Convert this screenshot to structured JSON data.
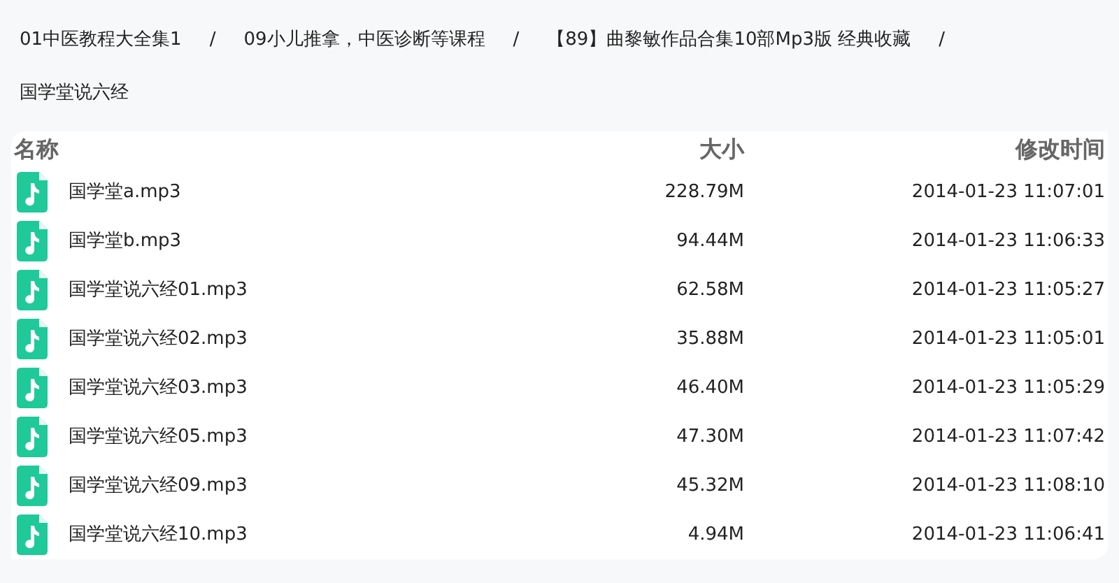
{
  "breadcrumb": {
    "separator": "/",
    "items": [
      {
        "label": "01中医教程大全集1"
      },
      {
        "label": "09小儿推拿，中医诊断等课程"
      },
      {
        "label": "【89】曲黎敏作品合集10部Mp3版 经典收藏"
      },
      {
        "label": "国学堂说六经"
      }
    ]
  },
  "table": {
    "columns": [
      "名称",
      "大小",
      "修改时间"
    ],
    "rows": [
      {
        "name": "国学堂a.mp3",
        "size": "228.79M",
        "modified": "2014-01-23 11:07:01"
      },
      {
        "name": "国学堂b.mp3",
        "size": "94.44M",
        "modified": "2014-01-23 11:06:33"
      },
      {
        "name": "国学堂说六经01.mp3",
        "size": "62.58M",
        "modified": "2014-01-23 11:05:27"
      },
      {
        "name": "国学堂说六经02.mp3",
        "size": "35.88M",
        "modified": "2014-01-23 11:05:01"
      },
      {
        "name": "国学堂说六经03.mp3",
        "size": "46.40M",
        "modified": "2014-01-23 11:05:29"
      },
      {
        "name": "国学堂说六经05.mp3",
        "size": "47.30M",
        "modified": "2014-01-23 11:07:42"
      },
      {
        "name": "国学堂说六经09.mp3",
        "size": "45.32M",
        "modified": "2014-01-23 11:08:10"
      },
      {
        "name": "国学堂说六经10.mp3",
        "size": "4.94M",
        "modified": "2014-01-23 11:06:41"
      }
    ]
  }
}
